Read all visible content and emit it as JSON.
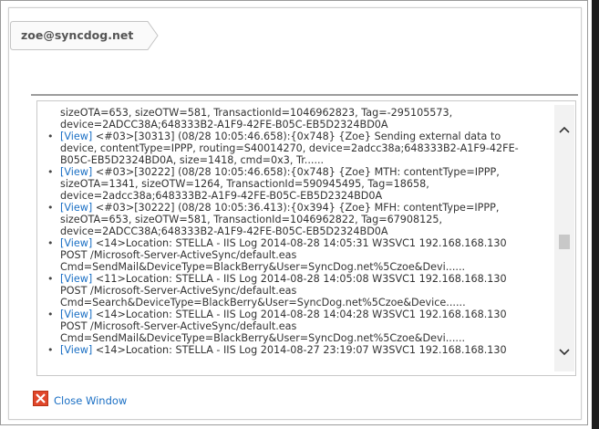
{
  "breadcrumb": {
    "label": "zoe@syncdog.net"
  },
  "log": {
    "view_label": "[View]",
    "partial_top": [
      "sizeOTA=653, sizeOTW=581, TransactionId=1046962823, Tag=-295105573,",
      "device=2ADCC38A;648333B2-A1F9-42FE-B05C-EB5D2324BD0A"
    ],
    "entries": [
      {
        "lines": [
          " <#03>[30313] (08/28 10:05:46.658):{0x748} {Zoe} Sending external data to",
          "device, contentType=IPPP, routing=S40014270, device=2adcc38a;648333B2-A1F9-42FE-",
          "B05C-EB5D2324BD0A, size=1418, cmd=0x3, Tr......"
        ]
      },
      {
        "lines": [
          " <#03>[30222] (08/28 10:05:46.658):{0x748} {Zoe} MTH: contentType=IPPP,",
          "sizeOTA=1341, sizeOTW=1264, TransactionId=590945495, Tag=18658,",
          "device=2adcc38a;648333B2-A1F9-42FE-B05C-EB5D2324BD0A"
        ]
      },
      {
        "lines": [
          " <#03>[30222] (08/28 10:05:36.413):{0x394} {Zoe} MFH: contentType=IPPP,",
          "sizeOTA=653, sizeOTW=581, TransactionId=1046962822, Tag=67908125,",
          "device=2ADCC38A;648333B2-A1F9-42FE-B05C-EB5D2324BD0A"
        ]
      },
      {
        "lines": [
          " <14>Location: STELLA - IIS Log 2014-08-28 14:05:31 W3SVC1 192.168.168.130",
          "POST /Microsoft-Server-ActiveSync/default.eas",
          "Cmd=SendMail&DeviceType=BlackBerry&User=SyncDog.net%5Czoe&Devi......"
        ]
      },
      {
        "lines": [
          " <11>Location: STELLA - IIS Log 2014-08-28 14:05:08 W3SVC1 192.168.168.130",
          "POST /Microsoft-Server-ActiveSync/default.eas",
          "Cmd=Search&DeviceType=BlackBerry&User=SyncDog.net%5Czoe&Device......"
        ]
      },
      {
        "lines": [
          " <14>Location: STELLA - IIS Log 2014-08-28 14:04:28 W3SVC1 192.168.168.130",
          "POST /Microsoft-Server-ActiveSync/default.eas",
          "Cmd=SendMail&DeviceType=BlackBerry&User=SyncDog.net%5Czoe&Devi......"
        ]
      },
      {
        "lines": [
          " <14>Location: STELLA - IIS Log 2014-08-27 23:19:07 W3SVC1 192.168.168.130"
        ]
      }
    ]
  },
  "footer": {
    "close_label": "Close Window"
  },
  "icons": {
    "close": "close-x-icon",
    "scroll_up": "chevron-up-icon",
    "scroll_down": "chevron-down-icon"
  },
  "colors": {
    "link": "#1a6fc4",
    "close_icon": "#e0462a"
  }
}
